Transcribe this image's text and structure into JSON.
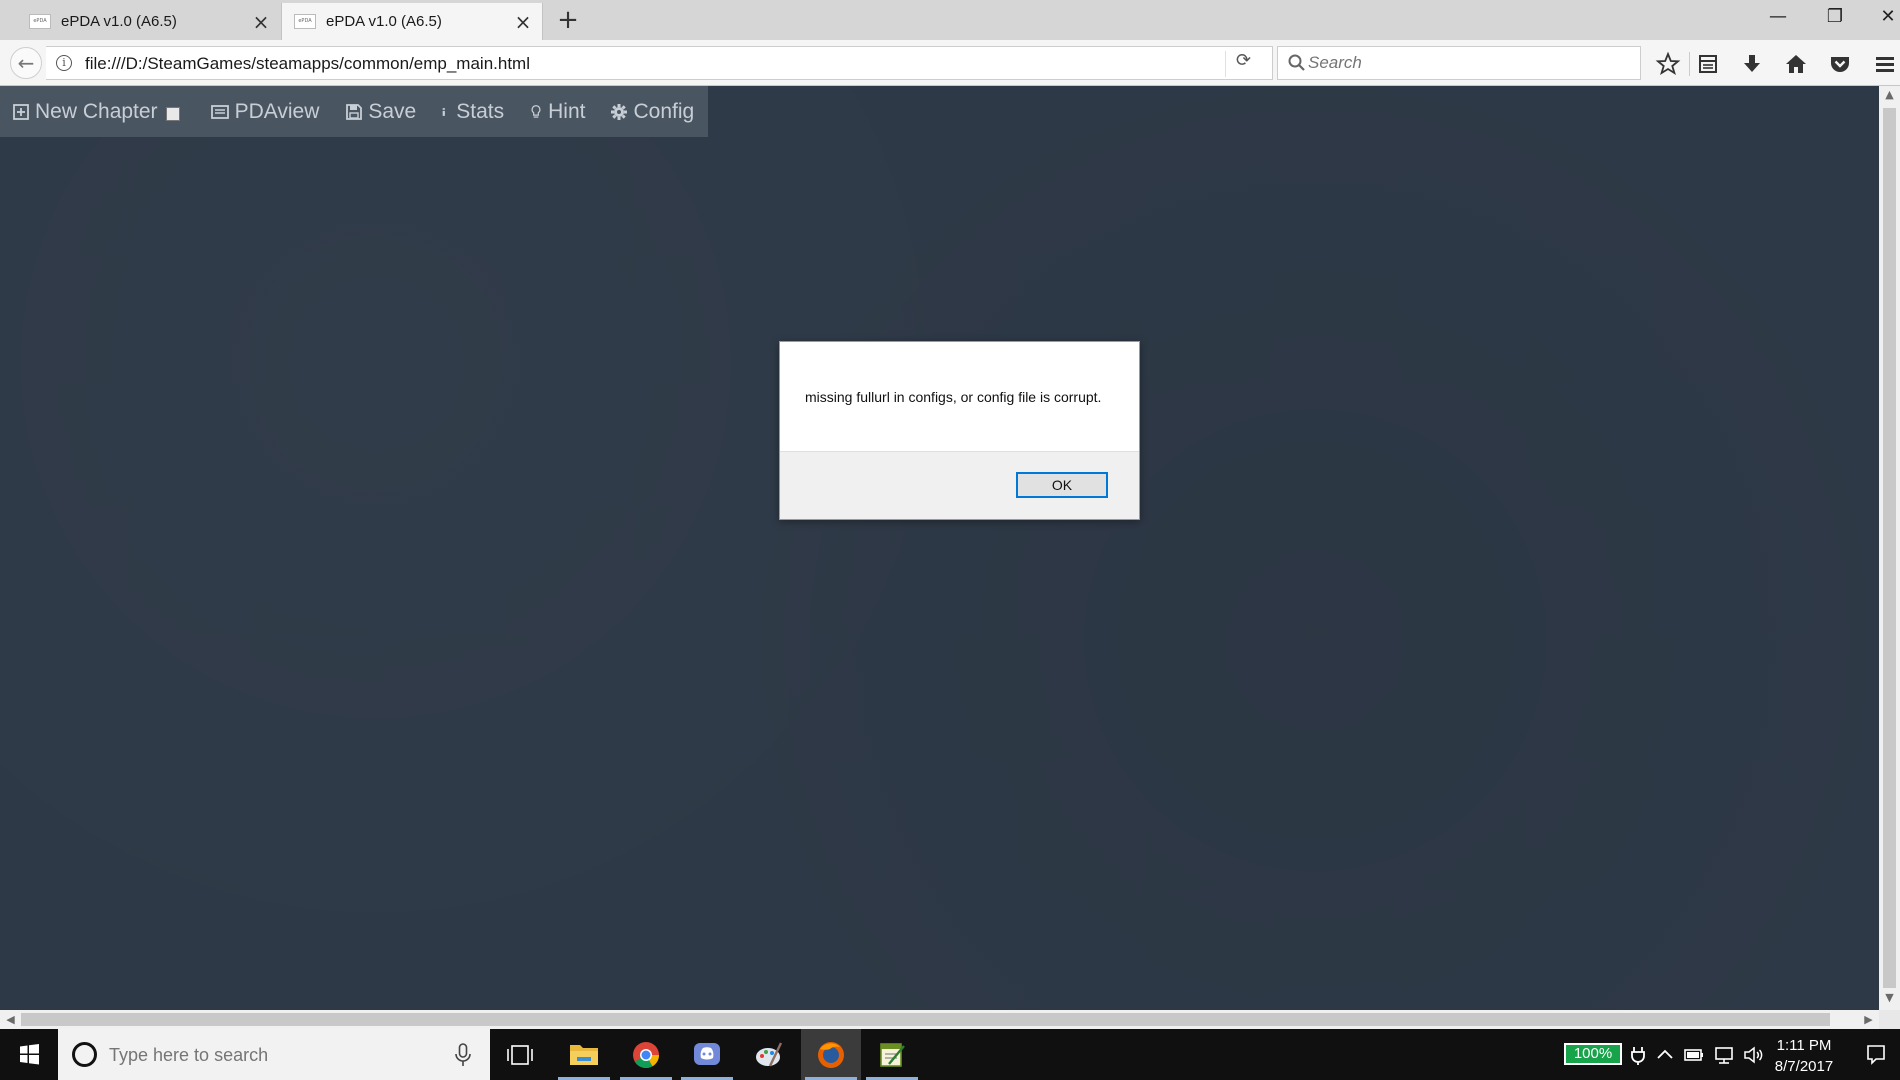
{
  "tabs": [
    {
      "title": "ePDA v1.0 (A6.5)",
      "favicon_text": "ePDA"
    },
    {
      "title": "ePDA v1.0 (A6.5)",
      "favicon_text": "ePDA"
    }
  ],
  "icons": {
    "tab_close": "×",
    "new_tab": "+",
    "minimize": "—",
    "restore": "❐",
    "close_window": "✕",
    "back": "←",
    "info": "i",
    "reload": "⟳"
  },
  "address": {
    "url": "file:///D:/SteamGames/steamapps/common/emp_main.html"
  },
  "search": {
    "placeholder": "Search"
  },
  "app_menu": {
    "new_chapter": "New Chapter",
    "pdaview": "PDAview",
    "save": "Save",
    "stats": "Stats",
    "hint": "Hint",
    "config": "Config"
  },
  "dialog": {
    "message": "missing fullurl in configs, or config file is corrupt.",
    "ok_label": "OK"
  },
  "taskbar": {
    "search_placeholder": "Type here to search",
    "battery": "100%",
    "time": "1:11 PM",
    "date": "8/7/2017"
  },
  "colors": {
    "page_background": "#2e3947",
    "menu_background": "#4a5562",
    "dialog_focus": "#0078d7",
    "battery": "#16a34a"
  }
}
